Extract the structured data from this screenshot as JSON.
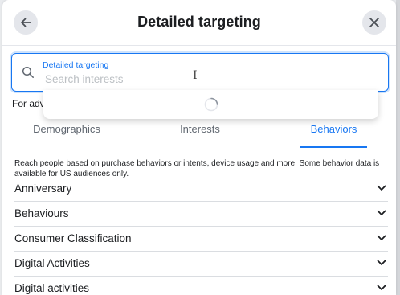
{
  "header": {
    "title": "Detailed targeting",
    "back_icon": "arrow-left-icon",
    "close_icon": "close-icon"
  },
  "search": {
    "label": "Detailed targeting",
    "placeholder": "Search interests",
    "value": ""
  },
  "helper_text": "For adv",
  "tabs": [
    {
      "label": "Demographics",
      "active": false
    },
    {
      "label": "Interests",
      "active": false
    },
    {
      "label": "Behaviors",
      "active": true
    }
  ],
  "description": "Reach people based on purchase behaviors or intents, device usage and more. Some behavior data is available for US audiences only.",
  "categories": [
    {
      "label": "Anniversary"
    },
    {
      "label": "Behaviours"
    },
    {
      "label": "Consumer Classification"
    },
    {
      "label": "Digital Activities"
    },
    {
      "label": "Digital activities"
    }
  ],
  "colors": {
    "accent": "#1877f2",
    "text": "#1c1e21",
    "muted": "#606770",
    "button_bg": "#e4e6eb"
  }
}
